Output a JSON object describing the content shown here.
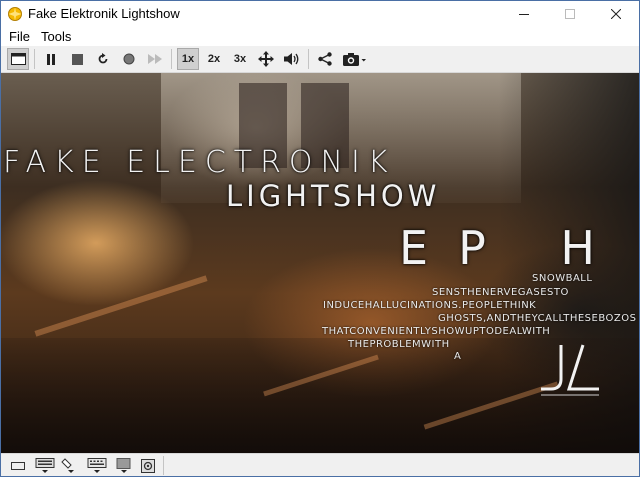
{
  "window": {
    "title": "Fake Elektronik Lightshow",
    "controls": [
      "minimize-icon",
      "maximize-icon",
      "close-icon"
    ]
  },
  "menu": {
    "items": [
      "File",
      "Tools"
    ]
  },
  "toolbar": {
    "zoom_1x": "1x",
    "zoom_2x": "2x",
    "zoom_3x": "3x",
    "active_zoom": "1x",
    "icons": [
      "fullscreen-icon",
      "pause-icon",
      "stop-icon",
      "restart-icon",
      "record-icon",
      "fast-forward-icon",
      "move-icon",
      "volume-icon",
      "share-icon",
      "screenshot-icon"
    ]
  },
  "screen": {
    "title_line1": "FAKE ELECTRONIK",
    "title_line2": "LIGHTSHOW",
    "title_line3": "EP H",
    "paragraph": [
      "SNOWBALL",
      "SENSTHENERVEGASESTO",
      "INDUCEHALLUCINATIONS.PEOPLETHINK",
      "GHOSTS,ANDTHEYCALLTHESEBOZOS",
      "THATCONVENIENTLYSHOWUPTODEALWITH",
      "THEPROBLEMWITH",
      "A"
    ]
  },
  "statusbar": {
    "icons": [
      "drive-icon",
      "keyboard-icon",
      "mouse-icon",
      "keypad-icon",
      "display-icon",
      "disk-icon"
    ]
  },
  "colors": {
    "titlebar": "#ffffff",
    "toolbar": "#f0f0f0",
    "app_icon": "#f5b800",
    "window_border": "#4a6fa5"
  }
}
